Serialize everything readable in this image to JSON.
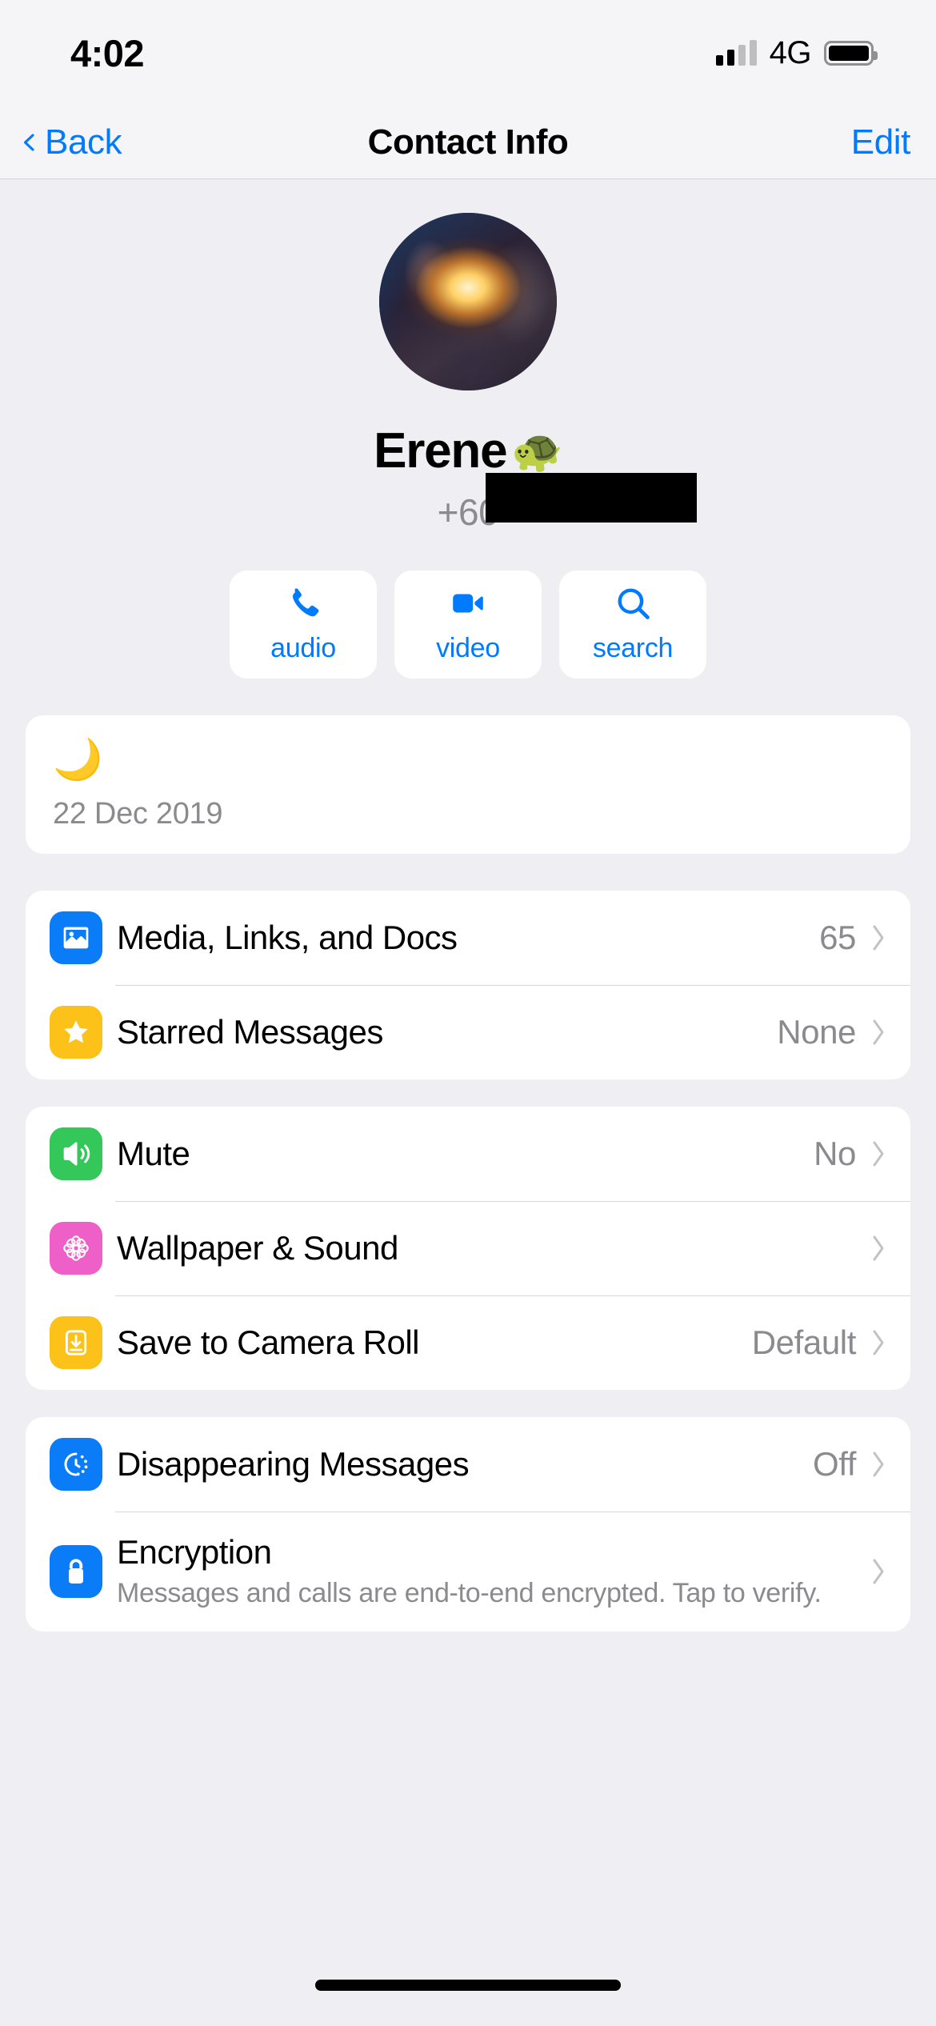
{
  "status_bar": {
    "time": "4:02",
    "network": "4G",
    "signal_icon": "signal-bars-icon",
    "battery_icon": "battery-full-icon"
  },
  "nav": {
    "back_label": "Back",
    "back_icon": "chevron-left-icon",
    "title": "Contact Info",
    "edit_label": "Edit"
  },
  "profile": {
    "avatar_alt": "contact-avatar",
    "name": "Erene",
    "name_emoji": "🐢",
    "phone_prefix": "+60",
    "phone_redacted": true
  },
  "actions": [
    {
      "label": "audio",
      "icon": "phone-icon"
    },
    {
      "label": "video",
      "icon": "video-camera-icon"
    },
    {
      "label": "search",
      "icon": "search-icon"
    }
  ],
  "status_update": {
    "emoji": "🌙",
    "date": "22 Dec 2019"
  },
  "sections": [
    {
      "name": "media-section",
      "rows": [
        {
          "label": "Media, Links, and Docs",
          "value": "65",
          "icon": "photos-icon",
          "icon_color": "#0a7cf8",
          "icon_class": "ic-blue"
        },
        {
          "label": "Starred Messages",
          "value": "None",
          "icon": "star-icon",
          "icon_color": "#fcc219",
          "icon_class": "ic-yellow"
        }
      ]
    },
    {
      "name": "chat-settings-section",
      "rows": [
        {
          "label": "Mute",
          "value": "No",
          "icon": "speaker-icon",
          "icon_color": "#34c759",
          "icon_class": "ic-green"
        },
        {
          "label": "Wallpaper & Sound",
          "value": "",
          "icon": "flower-icon",
          "icon_color": "#ef5fc8",
          "icon_class": "ic-pink"
        },
        {
          "label": "Save to Camera Roll",
          "value": "Default",
          "icon": "download-icon",
          "icon_color": "#fcc219",
          "icon_class": "ic-amber"
        }
      ]
    },
    {
      "name": "privacy-section",
      "rows": [
        {
          "label": "Disappearing Messages",
          "value": "Off",
          "icon": "timer-icon",
          "icon_color": "#0a7cf8",
          "icon_class": "ic-blue"
        },
        {
          "label": "Encryption",
          "value": "",
          "subtitle": "Messages and calls are end-to-end encrypted. Tap to verify.",
          "icon": "lock-icon",
          "icon_color": "#0a7cf8",
          "icon_class": "ic-blue"
        }
      ]
    }
  ],
  "colors": {
    "accent_blue": "#007aff",
    "background": "#efeef3",
    "card": "#ffffff",
    "secondary_text": "#8a8a8f"
  }
}
